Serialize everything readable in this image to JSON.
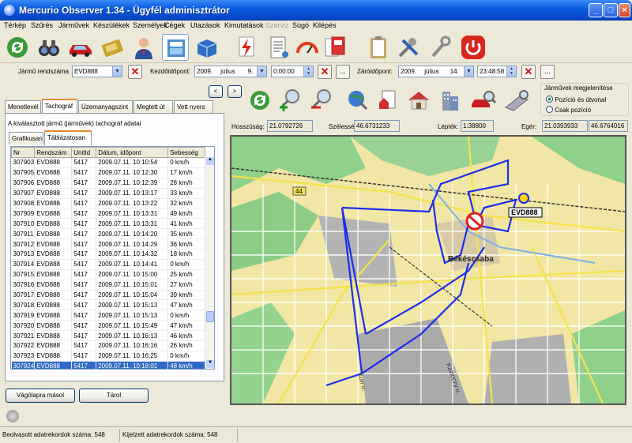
{
  "window": {
    "title": "Mercurio Observer 1.34 - Ügyfél adminisztrátor",
    "min": "_",
    "max": "□",
    "close": "×"
  },
  "menu": [
    "Térkép",
    "Szűrés",
    "Járművek",
    "Készülékek",
    "Személyek",
    "Cégek",
    "Utazások",
    "Kimutatások",
    "Szerviz",
    "Súgó",
    "Kilépés"
  ],
  "filter": {
    "vehicle_label": "Jármű rendszáma",
    "vehicle_value": "EVD888",
    "start_label": "Kezdőidőpont:",
    "start_year": "2009.",
    "start_month": "július",
    "start_day": "9.",
    "start_time": "0:00:00",
    "end_label": "Záróidőpont:",
    "end_year": "2009.",
    "end_month": "július",
    "end_day": "14.",
    "end_time": "23:48:58",
    "more": "...",
    "clear": "✕"
  },
  "tabs": [
    "Menetlevél",
    "Tachográf",
    "Üzemanyagszint",
    "Megtett út",
    "Vett nyers"
  ],
  "subtabs": [
    "Grafikusan",
    "Táblázatosan"
  ],
  "panel_caption": "A kiválasztott jármű (járművek) tachográf adatai",
  "table": {
    "headers": [
      "Nr",
      "Rendszám",
      "UnitId",
      "Dátum, időpont",
      "Sebesség"
    ],
    "rows": [
      [
        "307903",
        "EVD888",
        "5417",
        "2009.07.11. 10:10:54",
        "0 km/h"
      ],
      [
        "307905",
        "EVD888",
        "5417",
        "2009.07.11. 10:12:30",
        "17 km/h"
      ],
      [
        "307906",
        "EVD888",
        "5417",
        "2009.07.11. 10:12:39",
        "28 km/h"
      ],
      [
        "307907",
        "EVD888",
        "5417",
        "2009.07.11. 10:13:17",
        "33 km/h"
      ],
      [
        "307908",
        "EVD888",
        "5417",
        "2009.07.11. 10:13:22",
        "32 km/h"
      ],
      [
        "307909",
        "EVD888",
        "5417",
        "2009.07.11. 10:13:31",
        "49 km/h"
      ],
      [
        "307910",
        "EVD888",
        "5417",
        "2009.07.11. 10:13:31",
        "41 km/h"
      ],
      [
        "307911",
        "EVD888",
        "5417",
        "2009.07.11. 10:14:20",
        "35 km/h"
      ],
      [
        "307912",
        "EVD888",
        "5417",
        "2009.07.11. 10:14:29",
        "36 km/h"
      ],
      [
        "307913",
        "EVD888",
        "5417",
        "2009.07.11. 10:14:32",
        "18 km/h"
      ],
      [
        "307914",
        "EVD888",
        "5417",
        "2009.07.11. 10:14:41",
        "0 km/h"
      ],
      [
        "307915",
        "EVD888",
        "5417",
        "2009.07.11. 10:15:00",
        "25 km/h"
      ],
      [
        "307916",
        "EVD888",
        "5417",
        "2009.07.11. 10:15:01",
        "27 km/h"
      ],
      [
        "307917",
        "EVD888",
        "5417",
        "2009.07.11. 10:15:04",
        "39 km/h"
      ],
      [
        "307918",
        "EVD888",
        "5417",
        "2009.07.11. 10:15:13",
        "47 km/h"
      ],
      [
        "307919",
        "EVD888",
        "5417",
        "2009.07.11. 10:15:13",
        "0 km/h"
      ],
      [
        "307920",
        "EVD888",
        "5417",
        "2009.07.11. 10:15:49",
        "47 km/h"
      ],
      [
        "307921",
        "EVD888",
        "5417",
        "2009.07.11. 10:16:13",
        "46 km/h"
      ],
      [
        "307922",
        "EVD888",
        "5417",
        "2009.07.11. 10:16:16",
        "26 km/h"
      ],
      [
        "307923",
        "EVD888",
        "5417",
        "2009.07.11. 10:16:25",
        "0 km/h"
      ],
      [
        "307924",
        "EVD888",
        "5417",
        "2009.07.11. 10:18:01",
        "48 km/h"
      ]
    ],
    "selected_index": 20
  },
  "buttons": {
    "copy": "Vágólapra másol",
    "save": "Tárol",
    "nav_left": "<",
    "nav_right": ">"
  },
  "coords": {
    "lon_label": "Hosszúság:",
    "lon": "21.0792726",
    "lat_label": "Szélesség:",
    "lat": "46.6731233",
    "scale_label": "Lépték:",
    "scale": "1:38800",
    "mouse_label": "Egér:",
    "mouse_lon": "21.0393933",
    "mouse_lat": "46.6764016"
  },
  "display_group": {
    "title": "Járművek megjelenítése",
    "opt1": "Pozíció és útvonal",
    "opt2": "Csak pozíció"
  },
  "map": {
    "vehicle_label": "EVD888",
    "city_label": "Békéscsaba",
    "road_label": "44",
    "street1": "Kun u.",
    "street2": "Kazinczy u.",
    "route_color": "#1C2EEA"
  },
  "status": {
    "read": "Beolvasott adatrekordok száma: 548",
    "selected": "Kijelzett adatrekordok száma: 548"
  }
}
